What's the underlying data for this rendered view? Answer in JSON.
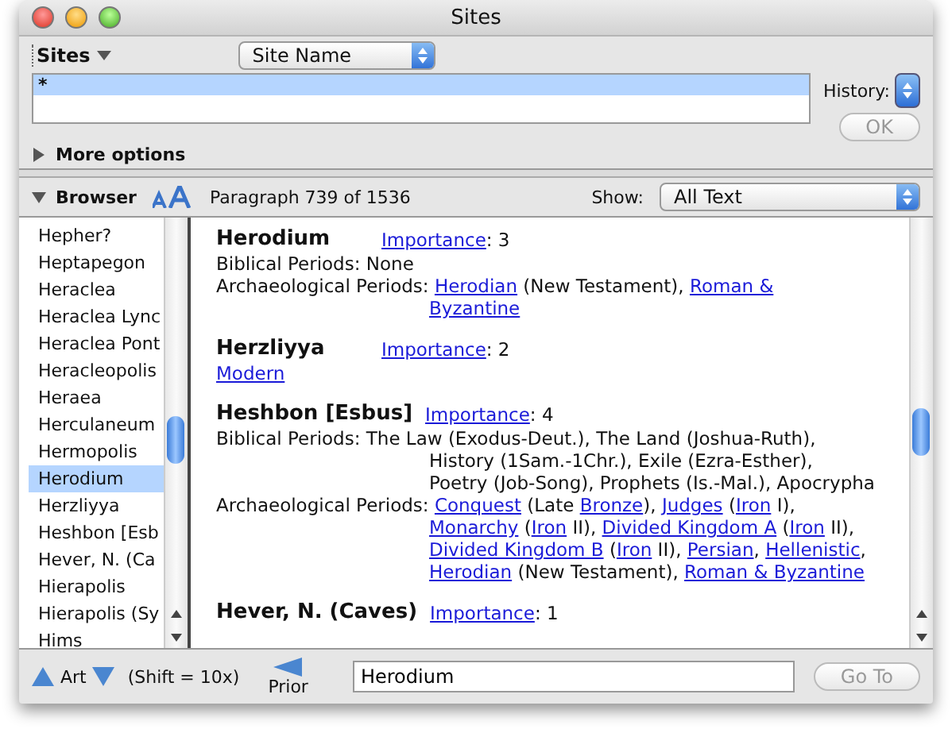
{
  "window": {
    "title": "Sites"
  },
  "search": {
    "scope_menu": "Sites",
    "field_menu": "Site Name",
    "query": "*",
    "history_label": "History:",
    "ok_button": {
      "label": "OK",
      "disabled": true
    },
    "more_options": {
      "label": "More options",
      "expanded": false
    }
  },
  "browser": {
    "label": "Browser",
    "expanded": true,
    "paragraph": "Paragraph 739  of 1536",
    "show_label": "Show:",
    "show_value": "All Text"
  },
  "site_list": [
    {
      "name": "Hepher?",
      "selected": false
    },
    {
      "name": "Heptapegon",
      "selected": false
    },
    {
      "name": "Heraclea",
      "selected": false
    },
    {
      "name": "Heraclea Lync",
      "selected": false
    },
    {
      "name": "Heraclea Pont",
      "selected": false
    },
    {
      "name": "Heracleopolis",
      "selected": false
    },
    {
      "name": "Heraea",
      "selected": false
    },
    {
      "name": "Herculaneum",
      "selected": false
    },
    {
      "name": "Hermopolis",
      "selected": false
    },
    {
      "name": "Herodium",
      "selected": true
    },
    {
      "name": "Herzliyya",
      "selected": false
    },
    {
      "name": "Heshbon [Esb",
      "selected": false
    },
    {
      "name": "Hever, N.  (Ca",
      "selected": false
    },
    {
      "name": "Hierapolis",
      "selected": false
    },
    {
      "name": "Hierapolis (Sy",
      "selected": false
    },
    {
      "name": "Hims",
      "selected": false
    }
  ],
  "entries": [
    {
      "name": "Herodium",
      "importance_link": "Importance",
      "importance_value": ": 3",
      "fields": [
        {
          "label": "Biblical Periods:",
          "lines": [
            [
              {
                "text": "None",
                "kind": "text"
              }
            ]
          ]
        },
        {
          "label": "Archaeological Periods:",
          "lines": [
            [
              {
                "text": "Herodian",
                "kind": "link"
              },
              {
                "text": " (New Testament), ",
                "kind": "text"
              },
              {
                "text": "Roman &",
                "kind": "link"
              }
            ],
            [
              {
                "text": "Byzantine",
                "kind": "link"
              }
            ]
          ]
        }
      ]
    },
    {
      "name": "Herzliyya",
      "importance_link": "Importance",
      "importance_value": ": 2",
      "fields": [
        {
          "lines": [
            [
              {
                "text": "Modern",
                "kind": "link"
              }
            ]
          ]
        }
      ]
    },
    {
      "name": "Heshbon [Esbus]",
      "importance_link": "Importance",
      "importance_value": ": 4",
      "fields": [
        {
          "label": "Biblical Periods:",
          "lines": [
            [
              {
                "text": "The Law (Exodus-Deut.), The Land (Joshua-Ruth),",
                "kind": "text"
              }
            ],
            [
              {
                "text": "History (1Sam.-1Chr.), Exile (Ezra-Esther),",
                "kind": "text"
              }
            ],
            [
              {
                "text": "Poetry (Job-Song), Prophets (Is.-Mal.), Apocrypha",
                "kind": "text"
              }
            ]
          ]
        },
        {
          "label": "Archaeological Periods:",
          "lines": [
            [
              {
                "text": "Conquest",
                "kind": "link"
              },
              {
                "text": " (Late ",
                "kind": "text"
              },
              {
                "text": "Bronze",
                "kind": "link"
              },
              {
                "text": "), ",
                "kind": "text"
              },
              {
                "text": "Judges",
                "kind": "link"
              },
              {
                "text": " (",
                "kind": "text"
              },
              {
                "text": "Iron",
                "kind": "link"
              },
              {
                "text": " I),",
                "kind": "text"
              }
            ],
            [
              {
                "text": "Monarchy",
                "kind": "link"
              },
              {
                "text": " (",
                "kind": "text"
              },
              {
                "text": "Iron",
                "kind": "link"
              },
              {
                "text": " II), ",
                "kind": "text"
              },
              {
                "text": "Divided Kingdom A",
                "kind": "link"
              },
              {
                "text": " (",
                "kind": "text"
              },
              {
                "text": "Iron",
                "kind": "link"
              },
              {
                "text": " II),",
                "kind": "text"
              }
            ],
            [
              {
                "text": "Divided Kingdom B",
                "kind": "link"
              },
              {
                "text": " (",
                "kind": "text"
              },
              {
                "text": "Iron",
                "kind": "link"
              },
              {
                "text": " II), ",
                "kind": "text"
              },
              {
                "text": "Persian",
                "kind": "link"
              },
              {
                "text": ", ",
                "kind": "text"
              },
              {
                "text": "Hellenistic",
                "kind": "link"
              },
              {
                "text": ",",
                "kind": "text"
              }
            ],
            [
              {
                "text": "Herodian",
                "kind": "link"
              },
              {
                "text": " (New Testament), ",
                "kind": "text"
              },
              {
                "text": "Roman & Byzantine",
                "kind": "link"
              }
            ]
          ]
        }
      ]
    },
    {
      "name": "Hever, N. (Caves)",
      "importance_link": "Importance",
      "importance_value": ": 1"
    }
  ],
  "footer": {
    "art_label": "Art",
    "shift_hint": "(Shift = 10x)",
    "prior_label": "Prior",
    "goto_value": "Herodium",
    "goto_button": {
      "label": "Go To",
      "disabled": true
    }
  }
}
